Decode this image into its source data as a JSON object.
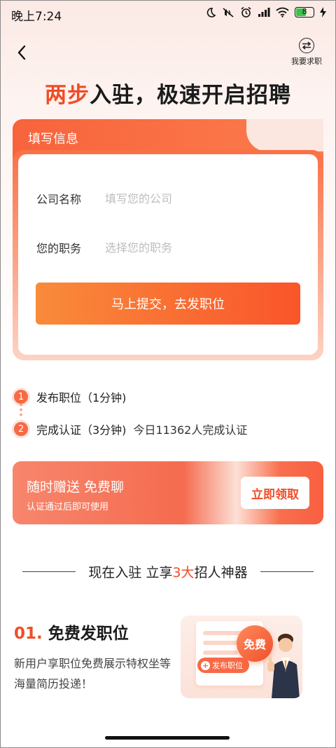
{
  "status_bar": {
    "time": "晚上7:24",
    "battery": "8",
    "icons": [
      "moon-icon",
      "mute-icon",
      "alarm-icon",
      "signal-icon",
      "wifi-icon",
      "battery-icon",
      "charging-icon"
    ]
  },
  "nav": {
    "back_icon": "chevron-left-icon",
    "switch_label": "我要求职"
  },
  "headline": {
    "accent": "两步",
    "rest": "入驻，极速开启招聘"
  },
  "form": {
    "tab_title": "填写信息",
    "company_label": "公司名称",
    "company_placeholder": "填写您的公司",
    "company_value": "",
    "position_label": "您的职务",
    "position_placeholder": "选择您的职务",
    "position_value": "",
    "submit_label": "马上提交，去发职位"
  },
  "steps": [
    {
      "num": "1",
      "text": "发布职位（1分钟)",
      "extra": ""
    },
    {
      "num": "2",
      "text": "完成认证（3分钟)",
      "extra": "今日11362人完成认证"
    }
  ],
  "promo": {
    "title": "随时赠送 免费聊",
    "subtitle": "认证通过后即可使用",
    "button": "立即领取"
  },
  "section": {
    "prefix": "现在入驻 立享",
    "accent": "3大",
    "suffix": "招人神器"
  },
  "feature": {
    "num": "01.",
    "title": "免费发职位",
    "desc": "新用户享职位免费展示特权坐等海量简历投递！",
    "badge": "免费",
    "chip": "发布职位"
  },
  "colors": {
    "accent": "#f04d27",
    "primary_gradient_start": "#f98b3a",
    "primary_gradient_end": "#f9552b"
  }
}
